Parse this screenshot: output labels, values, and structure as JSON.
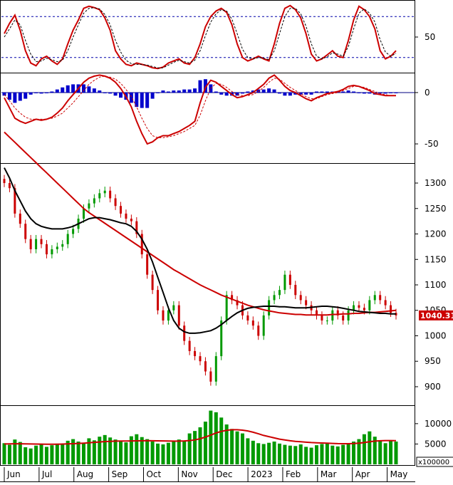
{
  "chart_data": [
    {
      "type": "line",
      "panel": "stochastic",
      "y_ticks": [
        "50"
      ],
      "y_tick_values": [
        50
      ],
      "ylim": [
        0,
        100
      ],
      "reference_lines": [
        80,
        20
      ],
      "series": [
        {
          "role": "k",
          "color": "#cc0000",
          "values": [
            55,
            70,
            82,
            60,
            30,
            12,
            8,
            18,
            22,
            15,
            10,
            18,
            40,
            60,
            75,
            92,
            95,
            93,
            90,
            78,
            60,
            30,
            18,
            10,
            8,
            12,
            10,
            8,
            5,
            4,
            6,
            12,
            15,
            18,
            12,
            10,
            20,
            40,
            65,
            80,
            88,
            92,
            86,
            68,
            40,
            20,
            15,
            18,
            22,
            18,
            15,
            40,
            70,
            92,
            96,
            90,
            78,
            55,
            25,
            15,
            18,
            24,
            30,
            22,
            20,
            45,
            75,
            95,
            90,
            80,
            62,
            30,
            18,
            22,
            30
          ]
        },
        {
          "role": "d",
          "color": "#000000",
          "dashed": true,
          "values": [
            50,
            62,
            75,
            68,
            45,
            25,
            14,
            15,
            19,
            17,
            14,
            16,
            30,
            50,
            68,
            85,
            92,
            93,
            91,
            83,
            68,
            45,
            28,
            16,
            11,
            10,
            10,
            9,
            7,
            5,
            5,
            9,
            13,
            16,
            14,
            12,
            16,
            30,
            52,
            72,
            84,
            90,
            88,
            76,
            55,
            32,
            20,
            18,
            20,
            19,
            17,
            30,
            55,
            80,
            92,
            92,
            84,
            66,
            40,
            22,
            18,
            21,
            27,
            25,
            22,
            36,
            62,
            85,
            91,
            85,
            72,
            46,
            28,
            22,
            26
          ]
        }
      ]
    },
    {
      "type": "line",
      "panel": "macd",
      "y_ticks": [
        "0",
        "-50"
      ],
      "y_tick_values": [
        0,
        -50
      ],
      "ylim": [
        -68,
        18
      ],
      "histogram_color": "#0000cc",
      "series": [
        {
          "role": "macd",
          "color": "#cc0000",
          "values": [
            -5,
            -15,
            -25,
            -28,
            -30,
            -28,
            -26,
            -27,
            -26,
            -24,
            -20,
            -15,
            -8,
            -2,
            4,
            10,
            14,
            16,
            17,
            16,
            14,
            10,
            4,
            -4,
            -14,
            -28,
            -40,
            -50,
            -48,
            -44,
            -42,
            -42,
            -40,
            -38,
            -35,
            -32,
            -28,
            -10,
            5,
            12,
            10,
            6,
            2,
            -2,
            -5,
            -4,
            -2,
            0,
            4,
            8,
            14,
            17,
            12,
            6,
            2,
            0,
            -3,
            -6,
            -8,
            -5,
            -3,
            -1,
            0,
            1,
            3,
            6,
            7,
            6,
            4,
            2,
            -1,
            -2,
            -3,
            -3,
            -3
          ]
        },
        {
          "role": "signal",
          "color": "#cc0000",
          "dashed": true,
          "values": [
            -2,
            -8,
            -15,
            -20,
            -24,
            -26,
            -26,
            -26,
            -26,
            -25,
            -23,
            -20,
            -15,
            -10,
            -4,
            2,
            8,
            12,
            15,
            16,
            15,
            13,
            9,
            3,
            -4,
            -14,
            -25,
            -35,
            -42,
            -44,
            -44,
            -43,
            -42,
            -40,
            -38,
            -35,
            -32,
            -22,
            -8,
            4,
            9,
            8,
            5,
            1,
            -2,
            -3,
            -3,
            -2,
            1,
            5,
            10,
            14,
            13,
            9,
            5,
            2,
            -1,
            -4,
            -6,
            -6,
            -4,
            -2,
            -1,
            0,
            2,
            4,
            6,
            6,
            5,
            3,
            1,
            -1,
            -2,
            -3,
            -3
          ]
        },
        {
          "role": "histogram",
          "values": [
            -3,
            -7,
            -10,
            -8,
            -6,
            -2,
            0,
            -1,
            0,
            1,
            3,
            5,
            7,
            8,
            8,
            8,
            6,
            4,
            2,
            0,
            -1,
            -3,
            -5,
            -7,
            -10,
            -14,
            -15,
            -15,
            -6,
            0,
            2,
            1,
            2,
            2,
            3,
            3,
            4,
            12,
            13,
            8,
            1,
            -2,
            -3,
            -3,
            -3,
            -1,
            1,
            2,
            3,
            3,
            4,
            3,
            -1,
            -3,
            -3,
            -2,
            -2,
            -2,
            -2,
            1,
            1,
            1,
            1,
            1,
            1,
            2,
            1,
            0,
            -1,
            -1,
            -2,
            -1,
            -1,
            0,
            0
          ]
        }
      ]
    },
    {
      "type": "candlestick",
      "panel": "price",
      "y_ticks": [
        "1300",
        "1250",
        "1200",
        "1150",
        "1100",
        "1050",
        "1000",
        "950",
        "900"
      ],
      "y_tick_values": [
        1300,
        1250,
        1200,
        1150,
        1100,
        1050,
        1000,
        950,
        900
      ],
      "ylim": [
        865,
        1335
      ],
      "last_price_label": "1040.310",
      "up_color": "#009900",
      "down_color": "#cc0000",
      "close": [
        1300,
        1290,
        1240,
        1220,
        1190,
        1170,
        1190,
        1180,
        1160,
        1170,
        1175,
        1180,
        1200,
        1210,
        1230,
        1250,
        1260,
        1270,
        1280,
        1285,
        1270,
        1255,
        1240,
        1230,
        1225,
        1200,
        1160,
        1120,
        1090,
        1050,
        1030,
        1050,
        1060,
        1020,
        990,
        970,
        960,
        950,
        930,
        910,
        960,
        1030,
        1080,
        1070,
        1060,
        1040,
        1030,
        1020,
        1000,
        1040,
        1070,
        1080,
        1090,
        1120,
        1100,
        1080,
        1070,
        1060,
        1050,
        1040,
        1030,
        1030,
        1050,
        1040,
        1030,
        1050,
        1060,
        1055,
        1050,
        1070,
        1080,
        1070,
        1060,
        1045,
        1040
      ],
      "ma_black": [
        1330,
        1310,
        1285,
        1265,
        1245,
        1230,
        1220,
        1215,
        1212,
        1210,
        1210,
        1210,
        1212,
        1215,
        1220,
        1225,
        1230,
        1232,
        1232,
        1230,
        1228,
        1225,
        1222,
        1220,
        1215,
        1205,
        1190,
        1170,
        1145,
        1115,
        1085,
        1055,
        1030,
        1015,
        1008,
        1005,
        1005,
        1006,
        1008,
        1010,
        1015,
        1022,
        1030,
        1038,
        1045,
        1050,
        1054,
        1056,
        1057,
        1058,
        1058,
        1058,
        1057,
        1057,
        1056,
        1055,
        1055,
        1055,
        1056,
        1057,
        1058,
        1058,
        1057,
        1056,
        1054,
        1052,
        1050,
        1048,
        1047,
        1046,
        1045,
        1044,
        1044,
        1043,
        1043
      ],
      "ma_red": [
        1400,
        1390,
        1380,
        1370,
        1360,
        1350,
        1340,
        1330,
        1320,
        1310,
        1300,
        1290,
        1280,
        1270,
        1260,
        1250,
        1242,
        1235,
        1228,
        1221,
        1214,
        1207,
        1200,
        1193,
        1186,
        1179,
        1172,
        1165,
        1158,
        1151,
        1144,
        1137,
        1130,
        1124,
        1118,
        1112,
        1106,
        1100,
        1095,
        1090,
        1085,
        1080,
        1076,
        1072,
        1068,
        1064,
        1060,
        1057,
        1054,
        1051,
        1049,
        1047,
        1045,
        1044,
        1043,
        1042,
        1042,
        1041,
        1041,
        1041,
        1041,
        1041,
        1042,
        1042,
        1043,
        1043,
        1044,
        1044,
        1045,
        1046,
        1046,
        1047,
        1048,
        1049,
        1050
      ],
      "low_mark": 882
    },
    {
      "type": "bar",
      "panel": "volume",
      "y_ticks": [
        "10000",
        "5000"
      ],
      "y_tick_values": [
        10000,
        5000
      ],
      "ylim": [
        0,
        14000
      ],
      "unit_label": "x100000",
      "bar_color": "#009900",
      "values": [
        5200,
        4800,
        6100,
        5500,
        4200,
        3900,
        4600,
        5000,
        4300,
        4700,
        5100,
        4900,
        5800,
        6200,
        5600,
        5300,
        6400,
        5900,
        6800,
        7200,
        6600,
        6100,
        5800,
        5400,
        6900,
        7400,
        6700,
        6200,
        5600,
        5100,
        4900,
        5300,
        5700,
        6100,
        5800,
        7600,
        8200,
        9100,
        10500,
        13200,
        12800,
        11500,
        9800,
        8700,
        8100,
        7600,
        6400,
        5800,
        5200,
        5000,
        5300,
        5600,
        5100,
        4800,
        4600,
        4500,
        4900,
        4300,
        4100,
        4700,
        5000,
        5200,
        4600,
        4400,
        4800,
        5100,
        5600,
        6200,
        7400,
        8100,
        6800,
        5700,
        5200,
        5900,
        5600
      ],
      "ma_red": [
        5000,
        5020,
        5050,
        5060,
        5040,
        5000,
        4980,
        4970,
        4960,
        4950,
        4960,
        4980,
        5020,
        5080,
        5150,
        5220,
        5300,
        5400,
        5500,
        5600,
        5650,
        5700,
        5720,
        5730,
        5750,
        5780,
        5800,
        5810,
        5800,
        5780,
        5750,
        5720,
        5700,
        5710,
        5750,
        5850,
        6000,
        6300,
        6700,
        7200,
        7700,
        8100,
        8350,
        8500,
        8500,
        8400,
        8200,
        7900,
        7500,
        7100,
        6800,
        6500,
        6200,
        6000,
        5800,
        5650,
        5550,
        5450,
        5350,
        5300,
        5250,
        5200,
        5150,
        5100,
        5080,
        5080,
        5120,
        5200,
        5350,
        5550,
        5700,
        5800,
        5850,
        5850,
        5820
      ]
    },
    {
      "type": "x-axis",
      "categories": [
        "Jun",
        "Jul",
        "Aug",
        "Sep",
        "Oct",
        "Nov",
        "Dec",
        "2023",
        "Feb",
        "Mar",
        "Apr",
        "May"
      ]
    }
  ]
}
